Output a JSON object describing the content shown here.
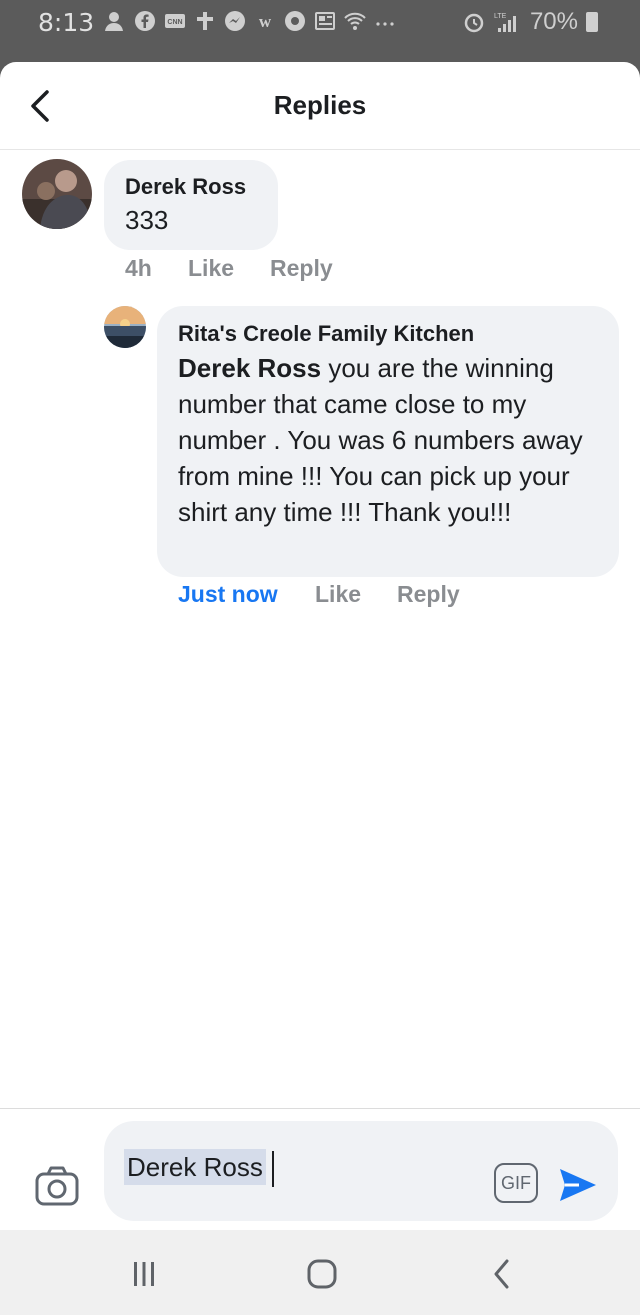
{
  "status_bar": {
    "time": "8:13",
    "battery": "70%",
    "signal_label": "LTE"
  },
  "header": {
    "title": "Replies"
  },
  "comments": [
    {
      "author": "Derek Ross",
      "text": "333",
      "time": "4h",
      "like": "Like",
      "reply": "Reply"
    }
  ],
  "replies": [
    {
      "author": "Rita's Creole Family Kitchen",
      "mention": "Derek Ross",
      "text": "you are the winning number that came close to my number . You was 6 numbers away from mine !!!  You can pick up your shirt any time !!! Thank you!!!",
      "time": "Just now",
      "like": "Like",
      "reply": "Reply"
    }
  ],
  "composer": {
    "value": "Derek Ross",
    "gif_label": "GIF"
  },
  "colors": {
    "accent": "#1877f2",
    "bubble": "#f0f2f5",
    "muted": "#8a8d91"
  }
}
